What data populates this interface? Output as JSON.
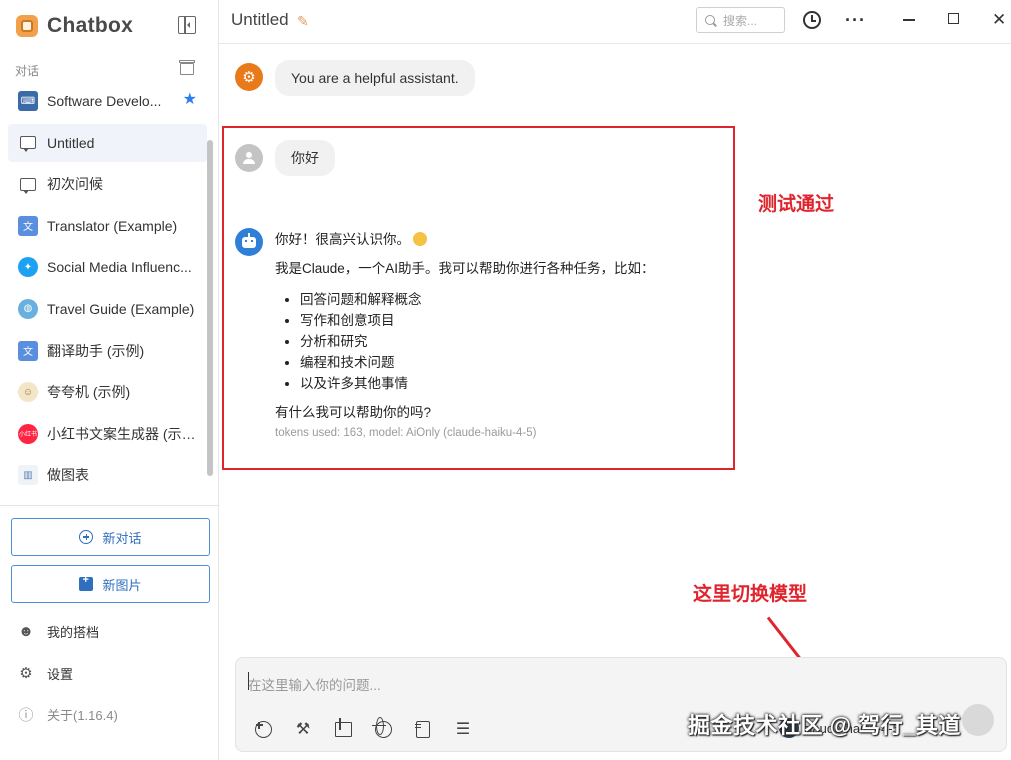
{
  "sidebar": {
    "brand": "Chatbox",
    "section_label": "对话",
    "conversations": [
      {
        "label": "Software Develo...",
        "icon": "dev-avatar-icon",
        "starred": true
      },
      {
        "label": "Untitled",
        "icon": "chat-bubble-icon",
        "active": true
      },
      {
        "label": "初次问候",
        "icon": "chat-bubble-icon"
      },
      {
        "label": "Translator (Example)",
        "icon": "translator-icon"
      },
      {
        "label": "Social Media Influenc...",
        "icon": "twitter-icon"
      },
      {
        "label": "Travel Guide (Example)",
        "icon": "globe-icon"
      },
      {
        "label": "翻译助手 (示例)",
        "icon": "translator-icon"
      },
      {
        "label": "夸夸机 (示例)",
        "icon": "cheer-icon"
      },
      {
        "label": "小红书文案生成器 (示例)",
        "icon": "xiaohongshu-icon",
        "icon_text": "小红书"
      },
      {
        "label": "做图表",
        "icon": "chart-icon"
      }
    ],
    "new_chat_label": "新对话",
    "new_image_label": "新图片",
    "my_partner_label": "我的搭档",
    "settings_label": "设置",
    "about_label": "关于(1.16.4)"
  },
  "header": {
    "title": "Untitled",
    "search_placeholder": "搜索..."
  },
  "messages": {
    "system": "You are a helpful assistant.",
    "user": "你好",
    "assistant": {
      "greeting": "你好！很高兴认识你。",
      "intro": "我是Claude，一个AI助手。我可以帮助你进行各种任务，比如：",
      "items": [
        "回答问题和解释概念",
        "写作和创意项目",
        "分析和研究",
        "编程和技术问题",
        "以及许多其他事情"
      ],
      "closing": "有什么我可以帮助你的吗?",
      "meta": "tokens used: 163, model: AiOnly (claude-haiku-4-5)"
    }
  },
  "annotations": {
    "test_passed": "测试通过",
    "switch_model": "这里切换模型"
  },
  "input": {
    "placeholder": "在这里输入你的问题...",
    "model_label": "claude-haiku-4-5"
  },
  "watermark": "掘金技术社区 @ 驾行_其道",
  "colors": {
    "accent": "#2f7fd8",
    "annotation_red": "#e0242d",
    "system_avatar": "#e87a1a"
  }
}
